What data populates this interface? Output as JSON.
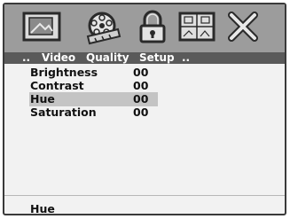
{
  "toolbar": {
    "icons": [
      {
        "name": "picture-icon"
      },
      {
        "name": "film-reel-icon"
      },
      {
        "name": "lock-icon"
      },
      {
        "name": "speaker-grid-icon"
      },
      {
        "name": "exit-icon"
      }
    ]
  },
  "menubar": {
    "prefix": "..",
    "items": [
      "Video",
      "Quality",
      "Setup"
    ],
    "suffix": ".."
  },
  "settings": {
    "rows": [
      {
        "label": "Brightness",
        "value": "00"
      },
      {
        "label": "Contrast",
        "value": "00"
      },
      {
        "label": "Hue",
        "value": "00"
      },
      {
        "label": "Saturation",
        "value": "00"
      }
    ],
    "selected_index": 2
  },
  "footer": {
    "text": "Hue"
  },
  "colors": {
    "icon_bar": "#9c9c9c",
    "menu_bar": "#5a5a5a",
    "panel": "#f2f2f2",
    "highlight": "#c4c4c4"
  }
}
